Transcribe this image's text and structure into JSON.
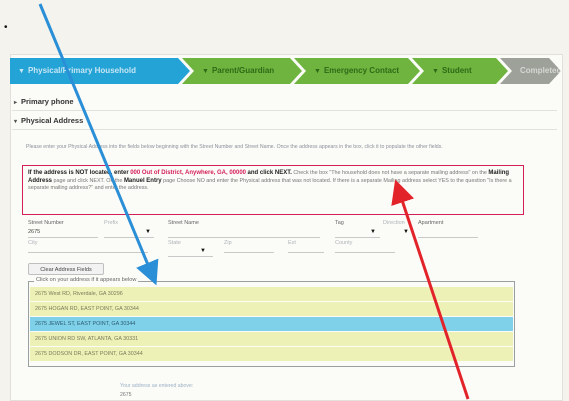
{
  "colors": {
    "step_active": "#23a3d6",
    "step_done": "#6fb43f",
    "step_last": "#9ea19a",
    "notice_border": "#d4205a",
    "row_highlight": "#eef1b5",
    "row_selected": "#7fd1ea",
    "arrow_blue": "#2a8fd6",
    "arrow_red": "#e2232a"
  },
  "wizard": {
    "steps": [
      {
        "label": "Physical/Primary Household"
      },
      {
        "label": "Parent/Guardian"
      },
      {
        "label": "Emergency Contact"
      },
      {
        "label": "Student"
      },
      {
        "label": "Completed"
      }
    ]
  },
  "sections": {
    "primary_phone": "Primary phone",
    "physical_address": "Physical Address"
  },
  "instructions": "Please enter your Physical Address into the fields below beginning with the Street Number and Street Name. Once the address appears in the box, click it to populate the other fields.",
  "notice": {
    "lead": "If the address is NOT located, enter",
    "fallback": "000 Out of District, Anywhere, GA, 00000",
    "lead_end": "and click NEXT.",
    "rest_1": "Check the box \"The household does not have a separate mailing address\" on the",
    "mailing": "Mailing Address",
    "rest_2": "page and click NEXT. On the",
    "manual": "Manuel Entry",
    "rest_3": "page Choose NO and enter the Physical address that was not located. If there is a separate Mailing address select YES to the question \"Is there a separate mailing address?\" and enter the address."
  },
  "fields": {
    "street_number": {
      "label": "Street Number",
      "value": "2675"
    },
    "prefix": {
      "label": "Prefix"
    },
    "street_name": {
      "label": "Street Name"
    },
    "tag": {
      "label": "Tag"
    },
    "direction": {
      "label": "Direction"
    },
    "apartment": {
      "label": "Apartment"
    },
    "city": {
      "label": "City"
    },
    "state": {
      "label": "State"
    },
    "zip": {
      "label": "Zip"
    },
    "ext": {
      "label": "Ext"
    },
    "county": {
      "label": "County"
    }
  },
  "clear_button": "Clear Address Fields",
  "results": {
    "legend": "Click on your address if it appears below",
    "items": [
      "2675 West RD, Riverdale, GA 30296",
      "2675 HOGAN RD, EAST POINT, GA 30344",
      "2675 JEWEL ST, EAST POINT, GA 30344",
      "2675 UNION RD SW, ATLANTA, GA 30331",
      "2675 DODSON DR, EAST POINT, GA 30344"
    ],
    "selected_index": 2
  },
  "footer": {
    "label": "Your address as entered above:",
    "value": "2675"
  }
}
